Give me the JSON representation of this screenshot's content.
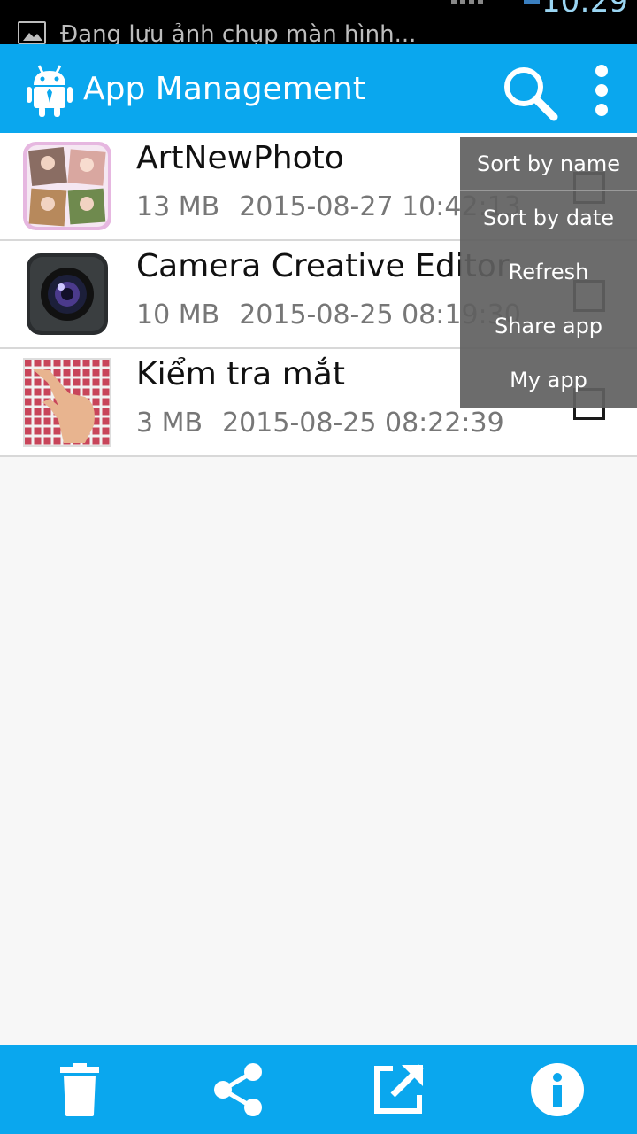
{
  "status_bar": {
    "notification_text": "Đang lưu ảnh chụp màn hình...",
    "clock": "10:29",
    "notification_icon": "image-icon"
  },
  "app_bar": {
    "title": "App Management",
    "logo_icon": "android-robot-icon",
    "search_icon": "search-icon",
    "overflow_icon": "more-vert-icon"
  },
  "apps": [
    {
      "name": "ArtNewPhoto",
      "size": "13 MB",
      "date": "2015-08-27 10:42:13",
      "checked": false
    },
    {
      "name": "Camera Creative Editor",
      "size": "10 MB",
      "date": "2015-08-25 08:19:30",
      "checked": false
    },
    {
      "name": "Kiểm tra mắt",
      "size": "3 MB",
      "date": "2015-08-25 08:22:39",
      "checked": false
    }
  ],
  "overflow_menu": {
    "items": [
      "Sort by name",
      "Sort by date",
      "Refresh",
      "Share app",
      "My app"
    ]
  },
  "bottom_bar": {
    "buttons": [
      "trash-icon",
      "share-icon",
      "open-external-icon",
      "info-icon"
    ]
  },
  "colors": {
    "accent": "#0aa7ee",
    "menu_background": "#606060",
    "status_bar": "#000000",
    "list_background": "#f7f7f7"
  }
}
